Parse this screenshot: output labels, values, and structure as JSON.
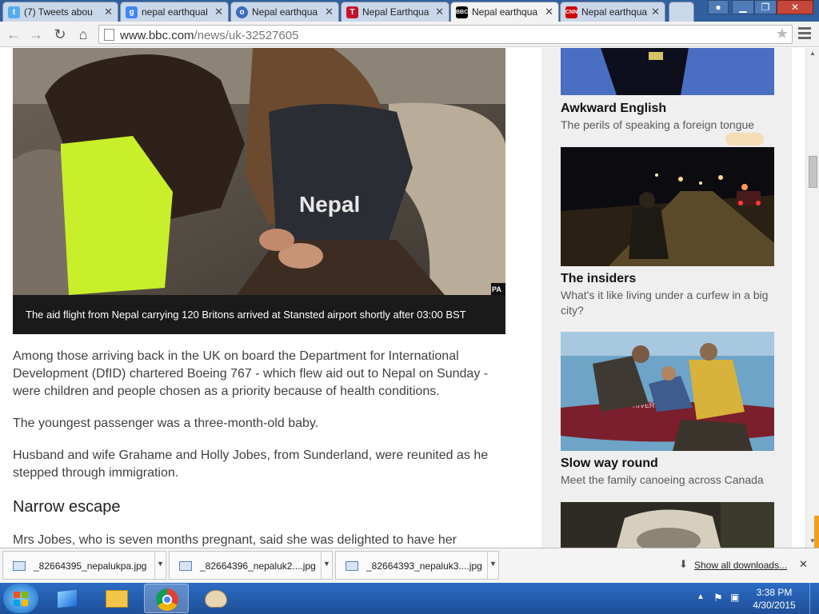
{
  "browser": {
    "tabs": [
      {
        "label": "(7) Tweets abou",
        "icon": "twitter-icon",
        "color": "#55acee"
      },
      {
        "label": "nepal earthqual",
        "icon": "google-icon",
        "color": "#4285f4"
      },
      {
        "label": "Nepal earthqua",
        "icon": "globe-icon",
        "color": "#3b6cb7"
      },
      {
        "label": "Nepal Earthqua",
        "icon": "telegraph-icon",
        "color": "#c4122f"
      },
      {
        "label": "Nepal earthqua",
        "icon": "bbc-icon",
        "color": "#000000",
        "active": true
      },
      {
        "label": "Nepal earthqua",
        "icon": "cnn-icon",
        "color": "#cc0000"
      }
    ],
    "url_host": "www.bbc.com",
    "url_path": "/news/uk-32527605"
  },
  "article": {
    "caption": "The aid flight from Nepal carrying 120 Britons arrived at Stansted airport shortly after 03:00 BST",
    "photo_credit": "PA",
    "shirt_text": "Nepal",
    "paragraphs": [
      "Among those arriving back in the UK on board the Department for International Development (DfID) chartered Boeing 767 - which flew aid out to Nepal on Sunday - were children and people chosen as a priority because of health conditions.",
      "The youngest passenger was a three-month-old baby.",
      "Husband and wife Grahame and Holly Jobes, from Sunderland, were reunited as he stepped through immigration."
    ],
    "subheading": "Narrow escape",
    "last_paragraph": "Mrs Jobes, who is seven months pregnant, said she was delighted to have her"
  },
  "sidebar": {
    "items": [
      {
        "title": "Awkward English",
        "subtitle": "The perils of speaking a foreign tongue"
      },
      {
        "title": "The insiders",
        "subtitle": "What's it like living under a curfew in a big city?"
      },
      {
        "title": "Slow way round",
        "subtitle": "Meet the family canoeing across Canada"
      }
    ],
    "canoe_text": "RIVER TAMEN"
  },
  "downloads": {
    "files": [
      "_82664395_nepalukpa.jpg",
      "_82664396_nepaluk2....jpg",
      "_82664393_nepaluk3....jpg"
    ],
    "show_all": "Show all downloads..."
  },
  "taskbar": {
    "time": "3:38 PM",
    "date": "4/30/2015"
  },
  "colors": {
    "taskbar": "#2b6cc3",
    "caption_bg": "#1a1a1a",
    "sidebar_bg": "#efefef",
    "vest": "#c8ef2a"
  }
}
